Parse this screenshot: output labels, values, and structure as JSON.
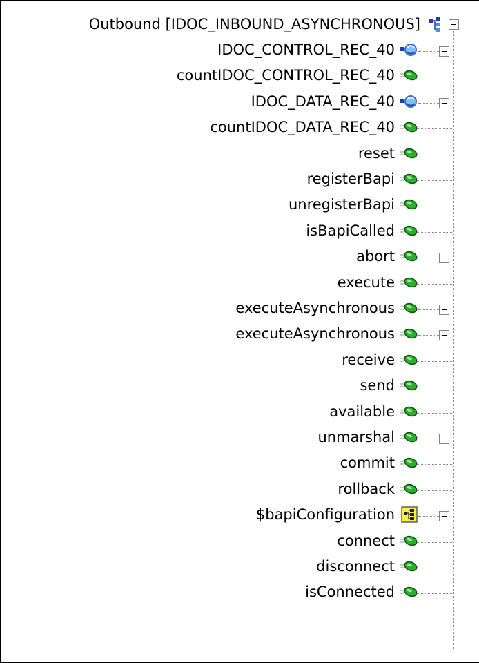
{
  "root": {
    "label": "Outbound [IDOC_INBOUND_ASYNCHRONOUS]",
    "icon": "class-structure-icon",
    "expanded": true
  },
  "items": [
    {
      "label": "IDOC_CONTROL_REC_40",
      "icon": "record-field-icon",
      "expandable": true
    },
    {
      "label": "countIDOC_CONTROL_REC_40",
      "icon": "method-icon",
      "expandable": false
    },
    {
      "label": "IDOC_DATA_REC_40",
      "icon": "record-field-icon",
      "expandable": true
    },
    {
      "label": "countIDOC_DATA_REC_40",
      "icon": "method-icon",
      "expandable": false
    },
    {
      "label": "reset",
      "icon": "method-icon",
      "expandable": false
    },
    {
      "label": "registerBapi",
      "icon": "method-icon",
      "expandable": false
    },
    {
      "label": "unregisterBapi",
      "icon": "method-icon",
      "expandable": false
    },
    {
      "label": "isBapiCalled",
      "icon": "method-icon",
      "expandable": false
    },
    {
      "label": "abort",
      "icon": "method-icon",
      "expandable": true
    },
    {
      "label": "execute",
      "icon": "method-icon",
      "expandable": false
    },
    {
      "label": "executeAsynchronous",
      "icon": "method-icon",
      "expandable": true
    },
    {
      "label": "executeAsynchronous",
      "icon": "method-icon",
      "expandable": true
    },
    {
      "label": "receive",
      "icon": "method-icon",
      "expandable": false
    },
    {
      "label": "send",
      "icon": "method-icon",
      "expandable": false
    },
    {
      "label": "available",
      "icon": "method-icon",
      "expandable": false
    },
    {
      "label": "unmarshal",
      "icon": "method-icon",
      "expandable": true
    },
    {
      "label": "commit",
      "icon": "method-icon",
      "expandable": false
    },
    {
      "label": "rollback",
      "icon": "method-icon",
      "expandable": false
    },
    {
      "label": "$bapiConfiguration",
      "icon": "structure-icon",
      "expandable": true
    },
    {
      "label": "connect",
      "icon": "method-icon",
      "expandable": false
    },
    {
      "label": "disconnect",
      "icon": "method-icon",
      "expandable": false
    },
    {
      "label": "isConnected",
      "icon": "method-icon",
      "expandable": false
    }
  ],
  "colors": {
    "method_green": "#2eae2e",
    "record_blue": "#2f6fd6",
    "structure_yellow": "#ffee44"
  }
}
